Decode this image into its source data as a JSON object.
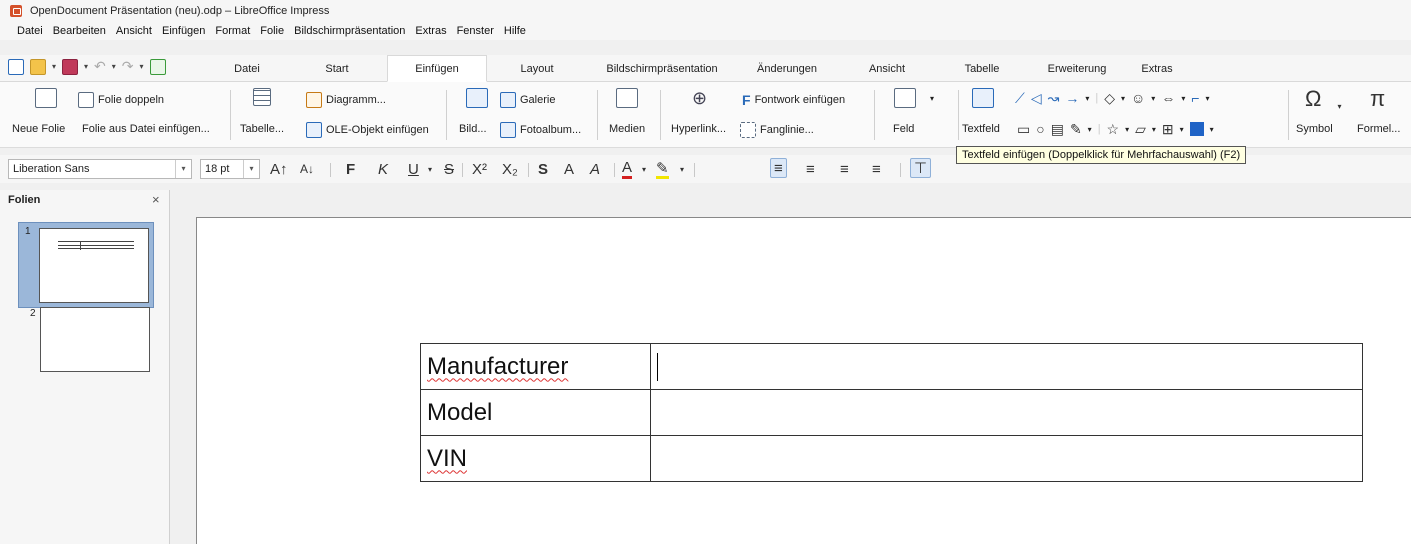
{
  "window": {
    "title": "OpenDocument Präsentation (neu).odp – LibreOffice Impress"
  },
  "menu": [
    "Datei",
    "Bearbeiten",
    "Ansicht",
    "Einfügen",
    "Format",
    "Folie",
    "Bildschirmpräsentation",
    "Extras",
    "Fenster",
    "Hilfe"
  ],
  "tabs": [
    {
      "label": "Datei",
      "w": 80
    },
    {
      "label": "Start",
      "w": 100
    },
    {
      "label": "Einfügen",
      "w": 100,
      "active": true
    },
    {
      "label": "Layout",
      "w": 100
    },
    {
      "label": "Bildschirmpräsentation",
      "w": 150
    },
    {
      "label": "Änderungen",
      "w": 100
    },
    {
      "label": "Ansicht",
      "w": 100
    },
    {
      "label": "Tabelle",
      "w": 90
    },
    {
      "label": "Erweiterung",
      "w": 100
    },
    {
      "label": "Extras",
      "w": 60
    }
  ],
  "ribbon": {
    "neue_folie": "Neue Folie",
    "folie_doppeln": "Folie doppeln",
    "folie_aus_datei": "Folie aus Datei einfügen...",
    "tabelle": "Tabelle...",
    "diagramm": "Diagramm...",
    "ole": "OLE-Objekt einfügen",
    "bild": "Bild...",
    "galerie": "Galerie",
    "fotoalbum": "Fotoalbum...",
    "medien": "Medien",
    "hyperlink": "Hyperlink...",
    "fontwork": "Fontwork einfügen",
    "fanglinie": "Fanglinie...",
    "feld": "Feld",
    "textfeld": "Textfeld",
    "symbol": "Symbol",
    "formel": "Formel..."
  },
  "format": {
    "font": "Liberation Sans",
    "size": "18 pt"
  },
  "tooltip": "Textfeld einfügen (Doppelklick für Mehrfachauswahl) (F2)",
  "slidepane": {
    "title": "Folien",
    "close": "×",
    "slide1": "1",
    "slide2": "2"
  },
  "table": {
    "rows": [
      {
        "label": "Manufacturer",
        "value": ""
      },
      {
        "label": "Model",
        "value": ""
      },
      {
        "label": "VIN",
        "value": ""
      }
    ]
  }
}
